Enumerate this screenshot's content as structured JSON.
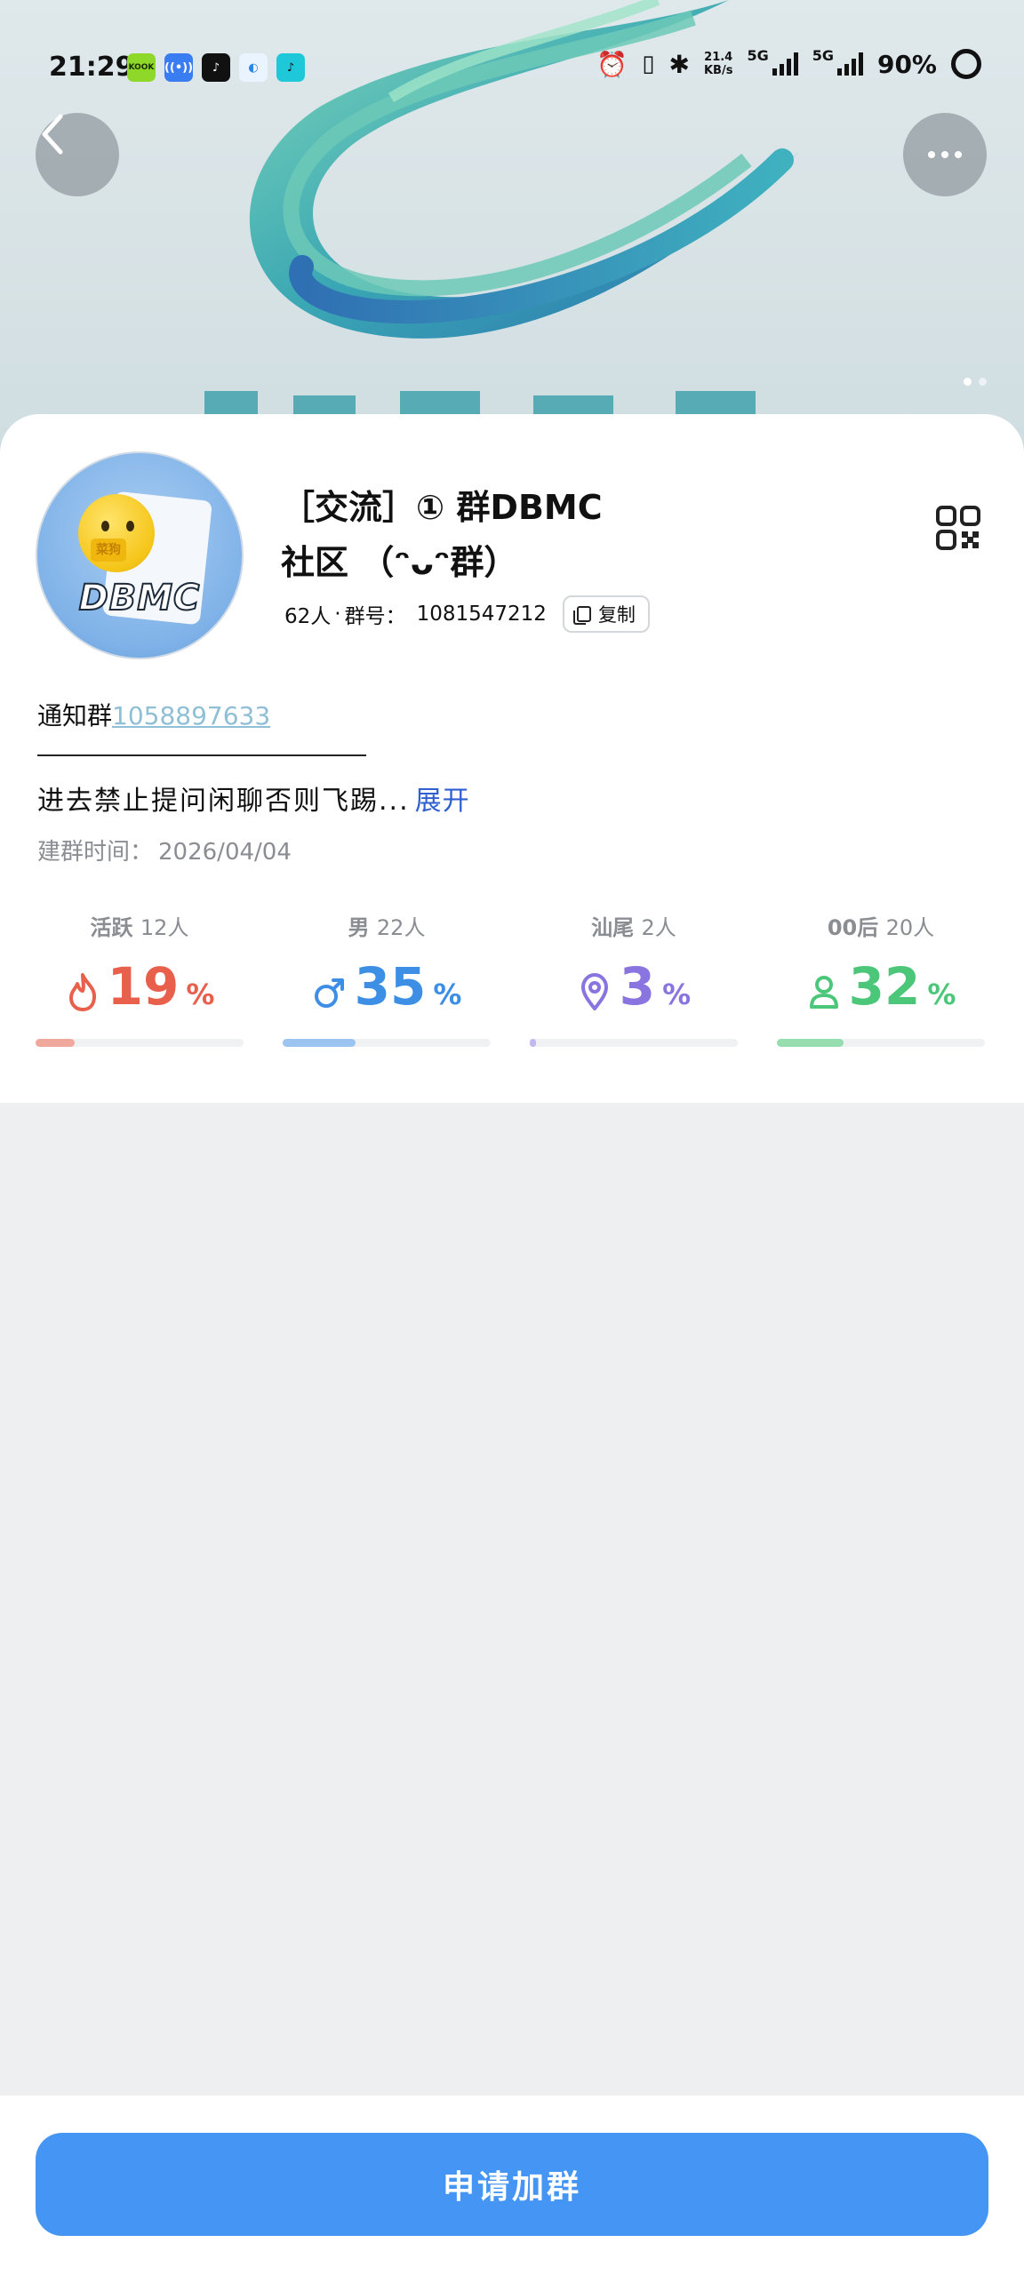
{
  "status_bar": {
    "time": "21:29",
    "network_speed": "21.4",
    "network_speed_unit": "KB/s",
    "sim1": "5G",
    "sim2": "5G",
    "battery": "90%",
    "app_icons": [
      "kook-icon",
      "broadcast-icon",
      "tiktok-icon",
      "qq-browser-icon",
      "tiktok-lite-icon"
    ]
  },
  "banner": {
    "page_count": 2,
    "current_page": 1
  },
  "group": {
    "avatar_text": "DBMC",
    "avatar_badge": "菜狗",
    "title_line1": "［交流］① 群DBMC",
    "title_line2": "社区 （ᵔᴗᵔ群）",
    "members": "62人",
    "separator": "·",
    "id_label": "群号：",
    "id": "1081547212",
    "copy_label": "复制"
  },
  "notice": {
    "label": "通知群",
    "link": "1058897633",
    "divider": "———————————————"
  },
  "description": {
    "text": "进去禁止提问闲聊否则飞踢...",
    "expand": "展开"
  },
  "created": {
    "label": "建群时间：",
    "value": "2026/04/04"
  },
  "stats": [
    {
      "label": "活跃",
      "count": "12人",
      "value": "19",
      "unit": "%",
      "percent": 19,
      "color": "#e8604c",
      "bar_color": "#f1a89c",
      "icon": "flame-icon"
    },
    {
      "label": "男",
      "count": "22人",
      "value": "35",
      "unit": "%",
      "percent": 35,
      "color": "#3d8fe6",
      "bar_color": "#9cc4f1",
      "icon": "male-icon"
    },
    {
      "label": "汕尾",
      "count": "2人",
      "value": "3",
      "unit": "%",
      "percent": 3,
      "color": "#8a74e0",
      "bar_color": "#c3b8ef",
      "icon": "location-pin-icon"
    },
    {
      "label": "00后",
      "count": "20人",
      "value": "32",
      "unit": "%",
      "percent": 32,
      "color": "#4cc77a",
      "bar_color": "#96deaf",
      "icon": "person-icon"
    }
  ],
  "join_button": "申请加群"
}
